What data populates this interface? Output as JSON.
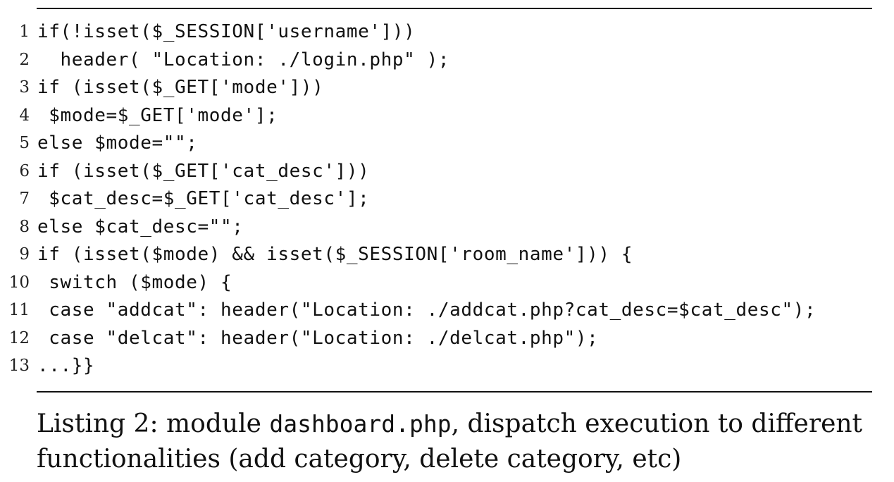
{
  "listing": {
    "lines": [
      {
        "number": "1",
        "code": "if(!isset($_SESSION['username']))"
      },
      {
        "number": "2",
        "code": "  header( \"Location: ./login.php\" );"
      },
      {
        "number": "3",
        "code": "if (isset($_GET['mode']))"
      },
      {
        "number": "4",
        "code": " $mode=$_GET['mode'];"
      },
      {
        "number": "5",
        "code": "else $mode=\"\";"
      },
      {
        "number": "6",
        "code": "if (isset($_GET['cat_desc']))"
      },
      {
        "number": "7",
        "code": " $cat_desc=$_GET['cat_desc'];"
      },
      {
        "number": "8",
        "code": "else $cat_desc=\"\";"
      },
      {
        "number": "9",
        "code": "if (isset($mode) && isset($_SESSION['room_name'])) {"
      },
      {
        "number": "10",
        "code": " switch ($mode) {"
      },
      {
        "number": "11",
        "code": " case \"addcat\": header(\"Location: ./addcat.php?cat_desc=$cat_desc\");"
      },
      {
        "number": "12",
        "code": " case \"delcat\": header(\"Location: ./delcat.php\");"
      },
      {
        "number": "13",
        "code": "...}}"
      }
    ]
  },
  "caption": {
    "prefix": "Listing 2:  module ",
    "filename": "dashboard.php",
    "suffix": ", dispatch execution to different functionalities (add category, delete category, etc)"
  }
}
